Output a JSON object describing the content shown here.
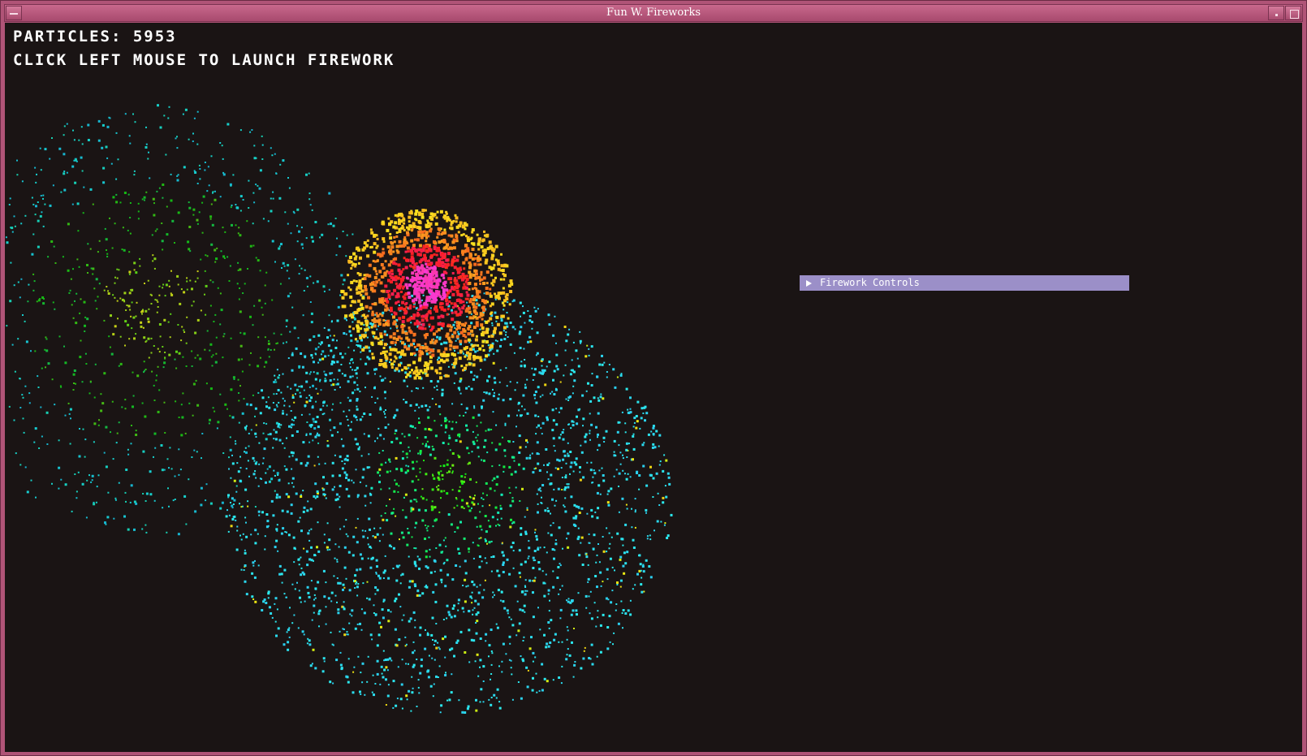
{
  "window": {
    "title": "Fun W. Fireworks"
  },
  "hud": {
    "particles_label": "Particles: 5953",
    "instructions": "Click left mouse to launch firework"
  },
  "controls_panel": {
    "header_label": "Firework Controls",
    "expanded": false
  },
  "colors": {
    "background": "#1a1414",
    "window_frame": "#b05477",
    "panel_header": "#9b8fc8",
    "hud_text": "#ffffff"
  },
  "icons": {
    "panel_toggle": "triangle-right-icon",
    "window_menu": "window-menu-icon",
    "minimize": "minimize-icon",
    "maximize": "maximize-icon"
  }
}
